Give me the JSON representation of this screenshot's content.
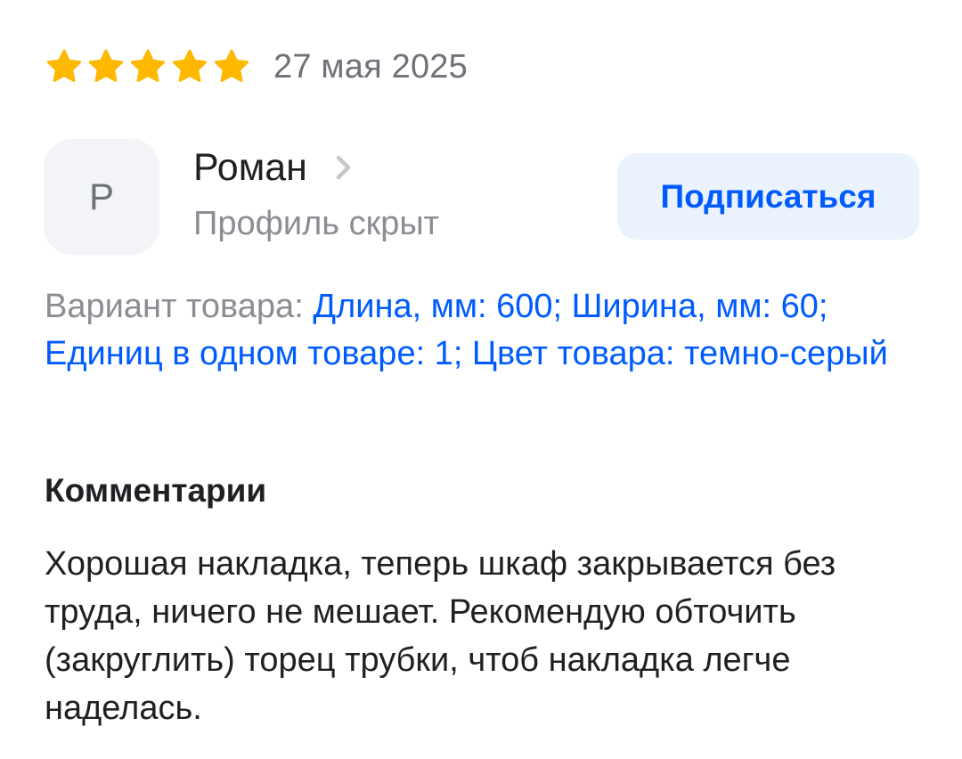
{
  "review": {
    "rating": 5,
    "max_rating": 5,
    "star_color": "#FFB800",
    "date": "27 мая 2025"
  },
  "author": {
    "avatar_letter": "Р",
    "name": "Роман",
    "profile_status": "Профиль скрыт",
    "chevron_icon": "chevron-right-icon"
  },
  "subscribe": {
    "label": "Подписаться"
  },
  "variant": {
    "label": "Вариант товара:",
    "value": "Длина, мм: 600; Ширина, мм: 60; Единиц в одном товаре: 1; Цвет товара: темно-серый"
  },
  "comments": {
    "heading": "Комментарии",
    "text": "Хорошая накладка, теперь шкаф закрывается без труда, ничего не мешает. Рекомендую обточить (закруглить) торец трубки, чтоб накладка легче наделась."
  },
  "colors": {
    "accent": "#005BFF",
    "button_bg": "#EAF2FE",
    "muted_text": "#8A8D94",
    "primary_text": "#1F2024"
  }
}
